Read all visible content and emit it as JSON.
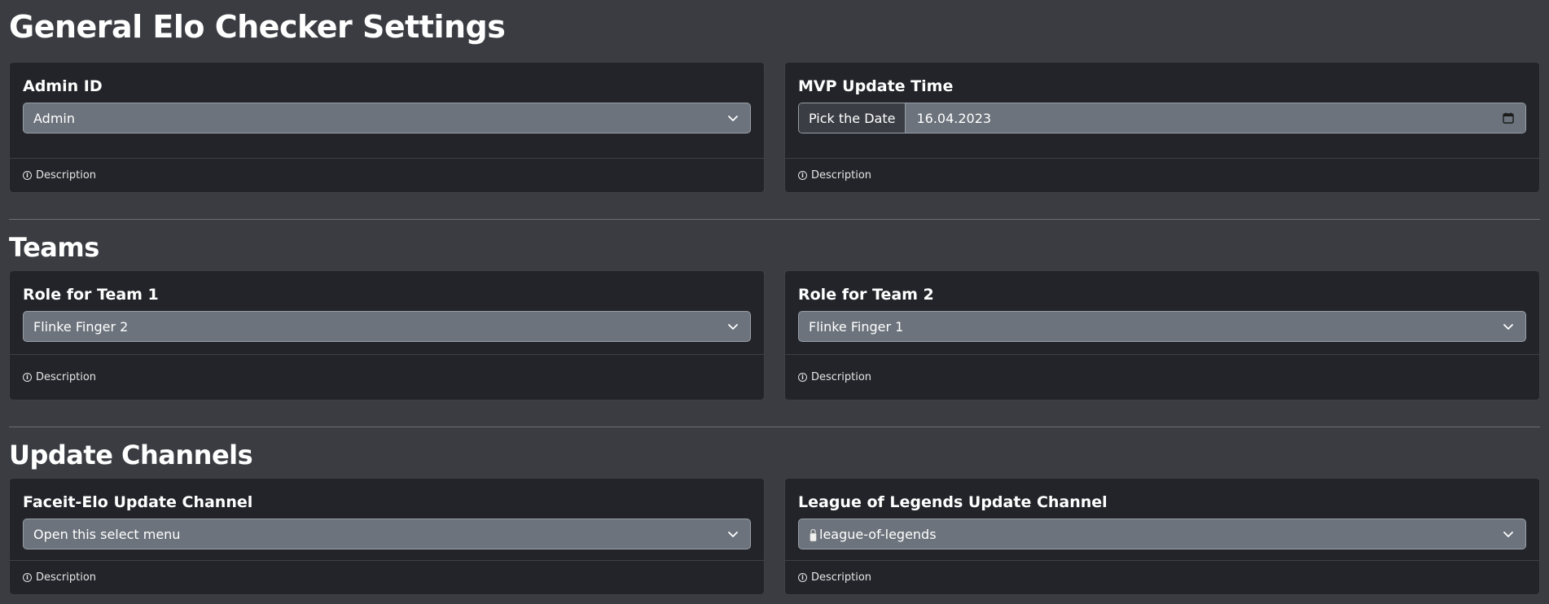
{
  "general": {
    "title": "General Elo Checker Settings",
    "admin_id": {
      "label": "Admin ID",
      "value": "Admin",
      "footer": "Description"
    },
    "mvp_update_time": {
      "label": "MVP Update Time",
      "prefix": "Pick the Date",
      "value": "16.04.2023",
      "footer": "Description"
    }
  },
  "teams": {
    "title": "Teams",
    "team1": {
      "label": "Role for Team 1",
      "value": "Flinke Finger 2",
      "footer": "Description"
    },
    "team2": {
      "label": "Role for Team 2",
      "value": "Flinke Finger 1",
      "footer": "Description"
    }
  },
  "update_channels": {
    "title": "Update Channels",
    "faceit": {
      "label": "Faceit-Elo Update Channel",
      "value": "Open this select menu",
      "footer": "Description"
    },
    "lol": {
      "label": "League of Legends Update Channel",
      "value": "league-of-legends",
      "footer": "Description"
    }
  },
  "colors": {
    "page_background": "#3b3c42",
    "card_background": "#222429",
    "input_background": "#6c737c",
    "input_border": "#9aa0a8"
  },
  "icons": {
    "select_arrow": "chevron-down-icon",
    "date_picker": "calendar-icon",
    "footer_info": "info-icon",
    "channel_lock": "lock-icon"
  }
}
